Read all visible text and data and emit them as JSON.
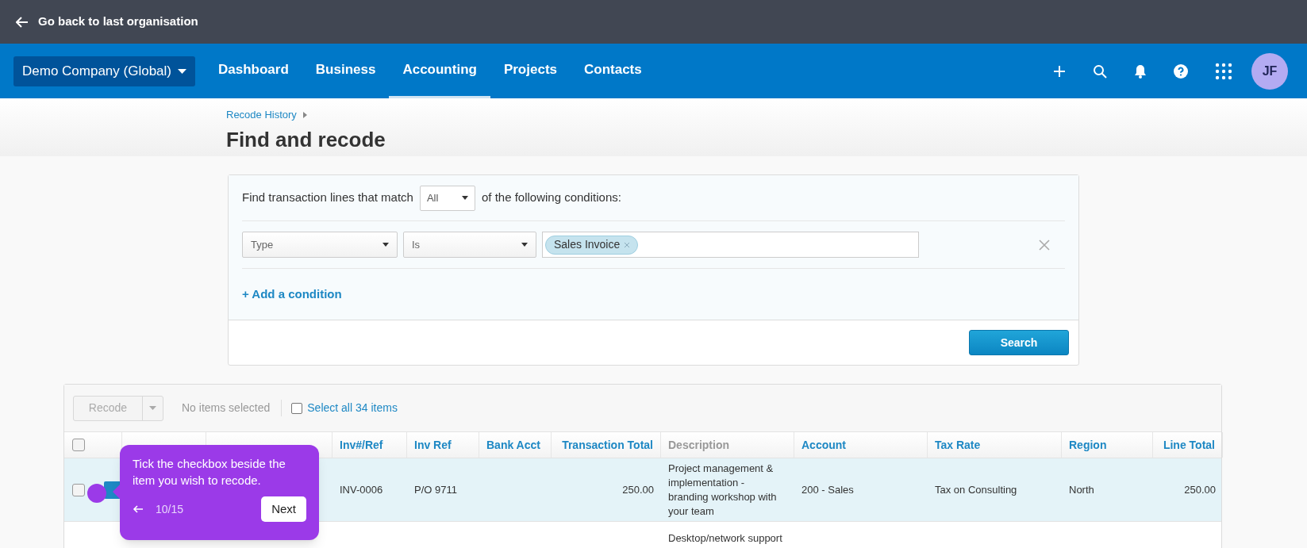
{
  "top_bar": {
    "back_label": "Go back to last organisation"
  },
  "nav": {
    "org": "Demo Company (Global)",
    "items": [
      {
        "label": "Dashboard",
        "selected": false
      },
      {
        "label": "Business",
        "selected": false
      },
      {
        "label": "Accounting",
        "selected": true
      },
      {
        "label": "Projects",
        "selected": false
      },
      {
        "label": "Contacts",
        "selected": false
      }
    ],
    "avatar": "JF"
  },
  "breadcrumb": "Recode History",
  "title": "Find and recode",
  "filter": {
    "intro": "Find transaction lines that match",
    "match": "All",
    "outro": "of the following conditions:",
    "conditions": [
      {
        "field": "Type",
        "operator": "Is",
        "tags": [
          "Sales Invoice"
        ]
      }
    ],
    "add_label": "+ Add a condition",
    "search_label": "Search"
  },
  "toolbar": {
    "recode_label": "Recode",
    "status": "No items selected",
    "select_all": "Select all 34 items",
    "select_all_checked": false
  },
  "table": {
    "header_checked": false,
    "columns": [
      {
        "label": "Inv#/Ref",
        "kind": "text",
        "sortable": true
      },
      {
        "label": "Inv Ref",
        "kind": "text",
        "sortable": true
      },
      {
        "label": "Bank Acct",
        "kind": "text",
        "sortable": true
      },
      {
        "label": "Transaction Total",
        "kind": "number",
        "sortable": true
      },
      {
        "label": "Description",
        "kind": "text",
        "sortable": false
      },
      {
        "label": "Account",
        "kind": "text",
        "sortable": true
      },
      {
        "label": "Tax Rate",
        "kind": "text",
        "sortable": true
      },
      {
        "label": "Region",
        "kind": "text",
        "sortable": true
      },
      {
        "label": "Line Total",
        "kind": "number",
        "sortable": true
      }
    ],
    "rows": [
      {
        "selected": true,
        "checked": false,
        "cells": [
          "INV-0006",
          "P/O 9711",
          null,
          "250.00",
          "Project management & implementation - branding workshop with your team",
          "200 - Sales",
          "Tax on Consulting",
          "North",
          "250.00"
        ]
      },
      {
        "selected": false,
        "cells": [
          null,
          null,
          null,
          null,
          "Desktop/network support",
          null,
          null,
          null,
          null
        ]
      }
    ]
  },
  "tour": {
    "message": "Tick the checkbox beside the item you wish to recode.",
    "step": "10/15",
    "next_label": "Next"
  }
}
